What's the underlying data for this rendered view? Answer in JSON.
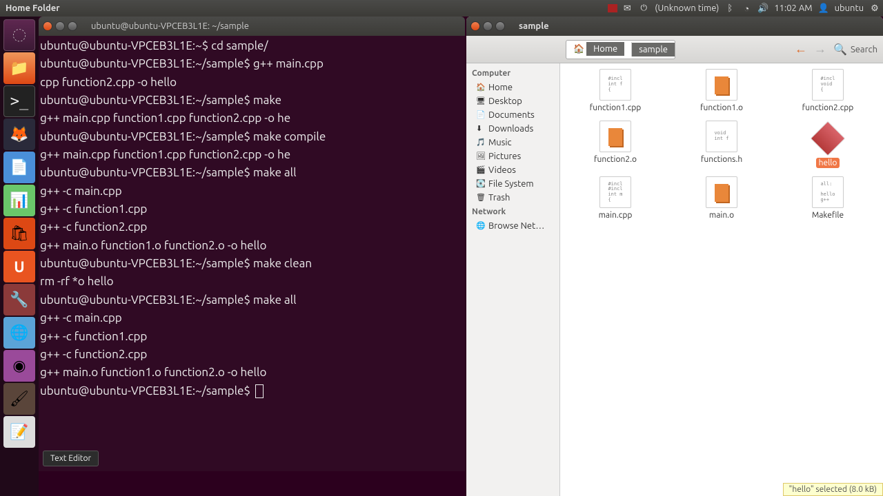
{
  "topbar": {
    "title": "Home Folder",
    "time_unknown": "(Unknown time)",
    "clock": "11:02 AM",
    "user": "ubuntu"
  },
  "launcher": {
    "tooltip": "Text Editor"
  },
  "terminal": {
    "title": "ubuntu@ubuntu-VPCEB3L1E: ~/sample",
    "lines": [
      "ubuntu@ubuntu-VPCEB3L1E:~$ cd sample/",
      "ubuntu@ubuntu-VPCEB3L1E:~/sample$ g++ main.cpp",
      "cpp function2.cpp -o hello",
      "ubuntu@ubuntu-VPCEB3L1E:~/sample$ make",
      "g++ main.cpp function1.cpp function2.cpp -o he",
      "ubuntu@ubuntu-VPCEB3L1E:~/sample$ make compile",
      "g++ main.cpp function1.cpp function2.cpp -o he",
      "ubuntu@ubuntu-VPCEB3L1E:~/sample$ make all",
      "g++ -c main.cpp",
      "g++ -c function1.cpp",
      "g++ -c function2.cpp",
      "g++ main.o function1.o function2.o -o hello",
      "ubuntu@ubuntu-VPCEB3L1E:~/sample$ make clean",
      "rm -rf *o hello",
      "ubuntu@ubuntu-VPCEB3L1E:~/sample$ make all",
      "g++ -c main.cpp",
      "g++ -c function1.cpp",
      "g++ -c function2.cpp",
      "g++ main.o function1.o function2.o -o hello",
      "ubuntu@ubuntu-VPCEB3L1E:~/sample$ "
    ]
  },
  "filemanager": {
    "title": "sample",
    "breadcrumb": {
      "home": "Home",
      "current": "sample"
    },
    "search": "Search",
    "sidebar": {
      "computer": "Computer",
      "items1": [
        "Home",
        "Desktop",
        "Documents",
        "Downloads",
        "Music",
        "Pictures",
        "Videos",
        "File System",
        "Trash"
      ],
      "network": "Network",
      "browse": "Browse Net…"
    },
    "files": [
      {
        "name": "function1.cpp",
        "type": "src",
        "preview": "#incl\nint f\n{"
      },
      {
        "name": "function1.o",
        "type": "obj"
      },
      {
        "name": "function2.cpp",
        "type": "src",
        "preview": "#incl\nvoid\n{"
      },
      {
        "name": "function2.o",
        "type": "obj"
      },
      {
        "name": "functions.h",
        "type": "src",
        "preview": "void\nint f\n"
      },
      {
        "name": "hello",
        "type": "exec",
        "selected": true
      },
      {
        "name": "main.cpp",
        "type": "src",
        "preview": "#incl\n#incl\nint m\n{"
      },
      {
        "name": "main.o",
        "type": "obj"
      },
      {
        "name": "Makefile",
        "type": "src",
        "preview": "all:\n \nhello\ng++\n"
      }
    ],
    "status": "\"hello\" selected (8.0 kB)"
  }
}
